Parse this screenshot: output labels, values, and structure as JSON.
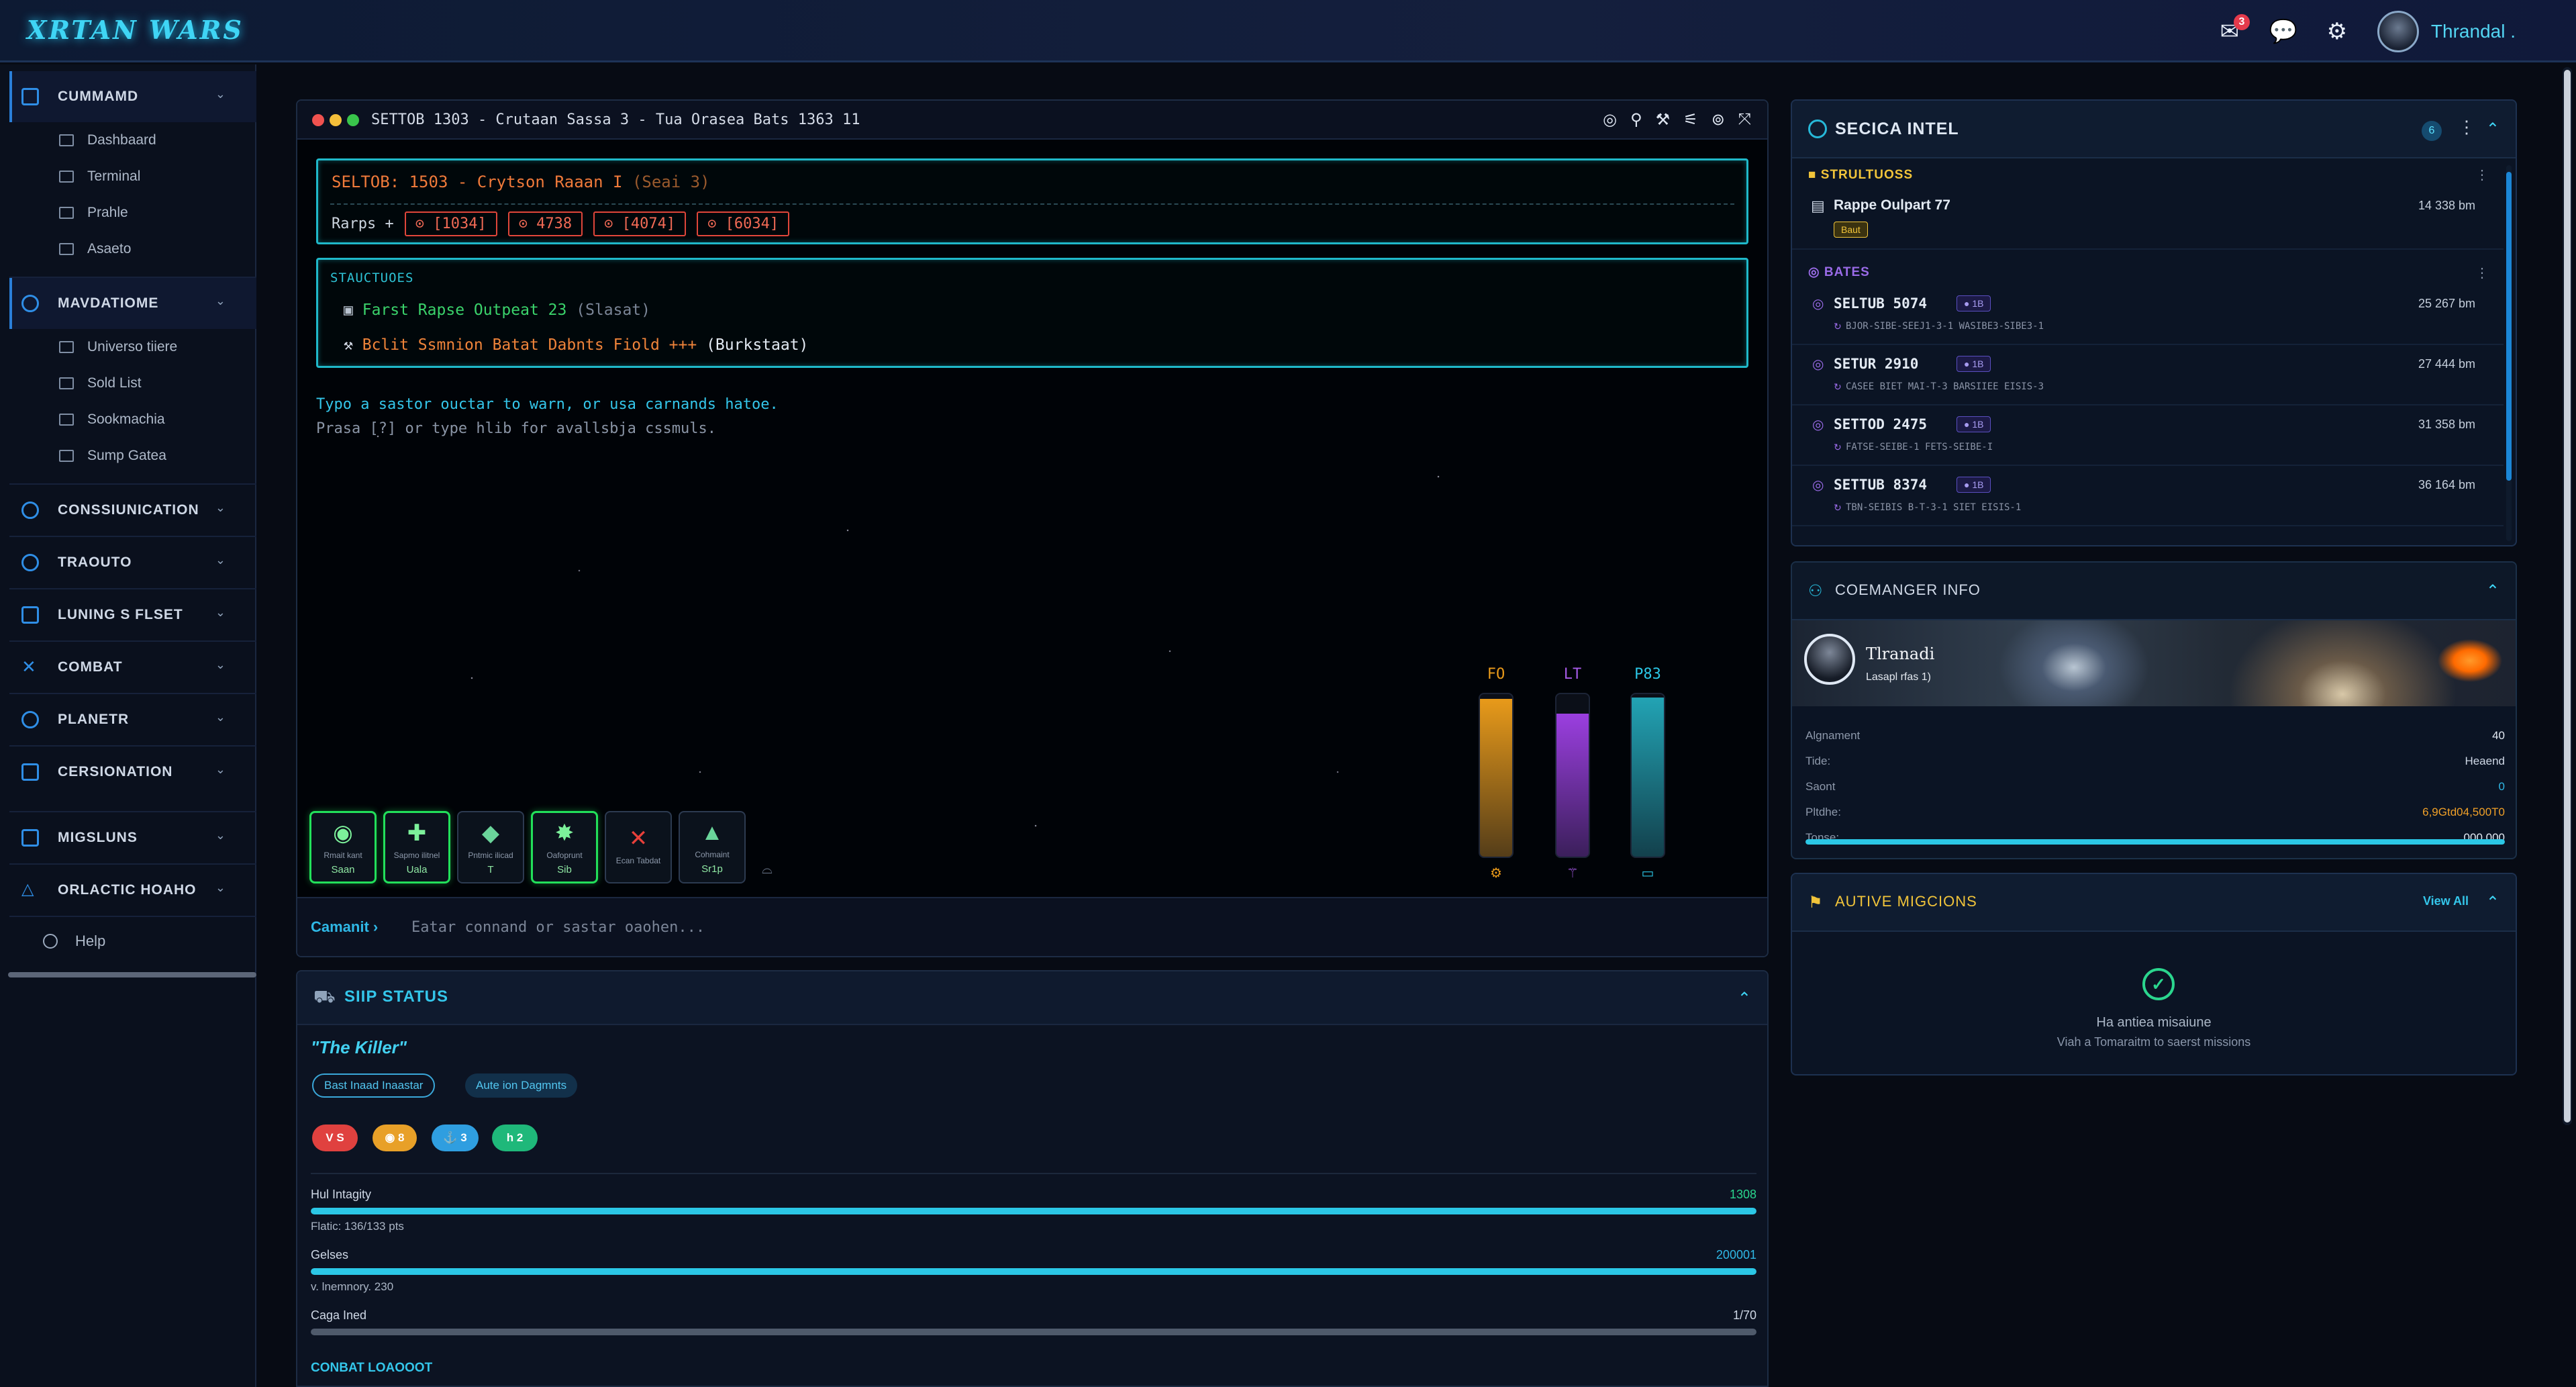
{
  "app": {
    "logo": "XRTAN WARS",
    "notification_count": "3",
    "user_name": "Thrandal ."
  },
  "sidebar": {
    "groups": [
      {
        "label": "CUMMAMD",
        "items": [
          "Dashbaard",
          "Terminal",
          "Prahle",
          "Asaeto"
        ]
      },
      {
        "label": "MAVDATIOME",
        "items": [
          "Universo tiiere",
          "Sold List",
          "Sookmachia",
          "Sump Gatea"
        ]
      },
      {
        "label": "CONSSIUNICATION"
      },
      {
        "label": "TRAOUTO"
      },
      {
        "label": "LUNING S FLSET"
      },
      {
        "label": "COMBAT"
      },
      {
        "label": "PLANETR"
      },
      {
        "label": "CERSIONATION"
      },
      {
        "label": "MIGSLUNS"
      },
      {
        "label": "ORLACTIC HOAHO"
      }
    ],
    "help_label": "Help"
  },
  "terminal": {
    "title": "SETTOB 1303 - Crutaan Sassa 3 - Tua Orasea Bats 1363 11",
    "sector_heading": "SELTOB: 1503 - Crytson Raaan I",
    "sector_heading_suffix": "(Seai 3)",
    "warps_label": "Rarps +",
    "warps": [
      "⊙ [1034]",
      "⊙ 4738",
      "⊙ [4074]",
      "⊙ [6034]"
    ],
    "structures_title": "STAUCTUOES",
    "structure_lines": [
      {
        "text": "Farst Rapse Outpeat 23",
        "suffix": "(Slasat)"
      },
      {
        "text": "Bclit Ssmnion Batat Dabnts Fiold +++",
        "suffix": "(Burkstaat)"
      }
    ],
    "msg_primary": "Typo a sastor ouctar to warn, or usa carnands hatoe.",
    "msg_secondary": "Prasa [?] or type hlib for avallsbja cssmuls.",
    "gauges": [
      {
        "label": "FO",
        "fill": 0.97,
        "color": "#e89a1a"
      },
      {
        "label": "LT",
        "fill": 0.88,
        "color": "#9b3fe0"
      },
      {
        "label": "P83",
        "fill": 0.98,
        "color": "#22a3b4"
      }
    ],
    "actions": [
      {
        "icon": "◉",
        "label": "Rmait kant",
        "value": "Saan",
        "style": "green",
        "icon_name": "scan-icon"
      },
      {
        "icon": "✚",
        "label": "Sapmo ilitnel",
        "value": "Uala",
        "style": "green",
        "icon_name": "plus-icon"
      },
      {
        "icon": "◆",
        "label": "Pntmic ilicad",
        "value": "T",
        "style": "plain",
        "icon_name": "gem-icon"
      },
      {
        "icon": "✸",
        "label": "Oafoprunt",
        "value": "Sib",
        "style": "green",
        "icon_name": "burst-icon"
      },
      {
        "icon": "✕",
        "label": "Ecan Tabdat",
        "value": "",
        "style": "plain",
        "icon_name": "close-icon"
      },
      {
        "icon": "▲",
        "label": "Cohmaint",
        "value": "Sr1p",
        "style": "plain",
        "icon_name": "ship-icon"
      }
    ],
    "command_label": "Camanit ›",
    "command_placeholder": "Eatar connand or sastar oaohen..."
  },
  "ship_status": {
    "title": "SIIP STATUS",
    "ship_name": "\"The Killer\"",
    "pill_1": "Bast Inaad Inaastar",
    "pill_2": "Aute ion Dagmnts",
    "chips": [
      {
        "text": "V S",
        "color": "#e0413f"
      },
      {
        "text": "◉ 8",
        "color": "#e8a028"
      },
      {
        "text": "⚓ 3",
        "color": "#2f9ee0"
      },
      {
        "text": "h 2",
        "color": "#1fb87a"
      }
    ],
    "bars": [
      {
        "label": "Hul Intagity",
        "value": "1308",
        "sub": "Flatic: 136/133 pts",
        "fill": 1.0,
        "color": "#2bc7e6",
        "value_color": "#2ad68e"
      },
      {
        "label": "Gelses",
        "value": "200001",
        "sub": "v. lnemnory. 230",
        "fill": 1.0,
        "color": "#2bc7e6",
        "value_color": "#2fb8e6"
      },
      {
        "label": "Caga Ined",
        "value": "1/70",
        "sub": "",
        "fill": 1.0,
        "color": "#4f5a6b",
        "value_color": "#cfd8e6"
      }
    ],
    "loadout_title": "CONBAT LOAOOOT"
  },
  "intel": {
    "title": "SECICA INTEL",
    "count": "6",
    "structures_label": "STRULTUOSS",
    "structure": {
      "name": "Rappe Oulpart 77",
      "tag": "Baut",
      "distance": "14 338 bm"
    },
    "gates_label": "BATES",
    "gates": [
      {
        "name": "SELTUB 5074",
        "tag": "● 1B",
        "sub": "BJOR-SIBE-SEEJ1-3-1 WASIBE3-SIBE3-1",
        "distance": "25 267 bm"
      },
      {
        "name": "SETUR 2910",
        "tag": "● 1B",
        "sub": "CASEE BIET MAI-T-3 BARSIIEE EISIS-3",
        "distance": "27 444 bm"
      },
      {
        "name": "SETTOD 2475",
        "tag": "● 1B",
        "sub": "FATSE-SEIBE-1 FETS-SEIBE-I",
        "distance": "31 358 bm"
      },
      {
        "name": "SETTUB 8374",
        "tag": "● 1B",
        "sub": "TBN-SEIBIS B-T-3-1 SIET EISIS-1",
        "distance": "36 164 bm"
      }
    ]
  },
  "commander": {
    "title": "COEMANGER INFO",
    "name": "Tlranadi",
    "sub": "Lasapl rfas    1)",
    "fields": [
      {
        "key": "Algnament",
        "value": "40",
        "color": "#e3eaf3"
      },
      {
        "key": "Tide:",
        "value": "Heaend",
        "color": "#cfd8e6"
      },
      {
        "key": "Saont",
        "value": "0",
        "color": "#2fb8e6"
      },
      {
        "key": "Pltdhe:",
        "value": "6,9Gtd04,500T0",
        "color": "#f0a028"
      },
      {
        "key": "Tonse:",
        "value": "000 000",
        "color": "#e3eaf3"
      }
    ],
    "progress": 1.0
  },
  "missions": {
    "title": "AUTIVE MIGCIONS",
    "view_all": "View All",
    "empty_title": "Ha antiea misaiune",
    "empty_sub": "Viah a Tomaraitm to saerst missions"
  }
}
